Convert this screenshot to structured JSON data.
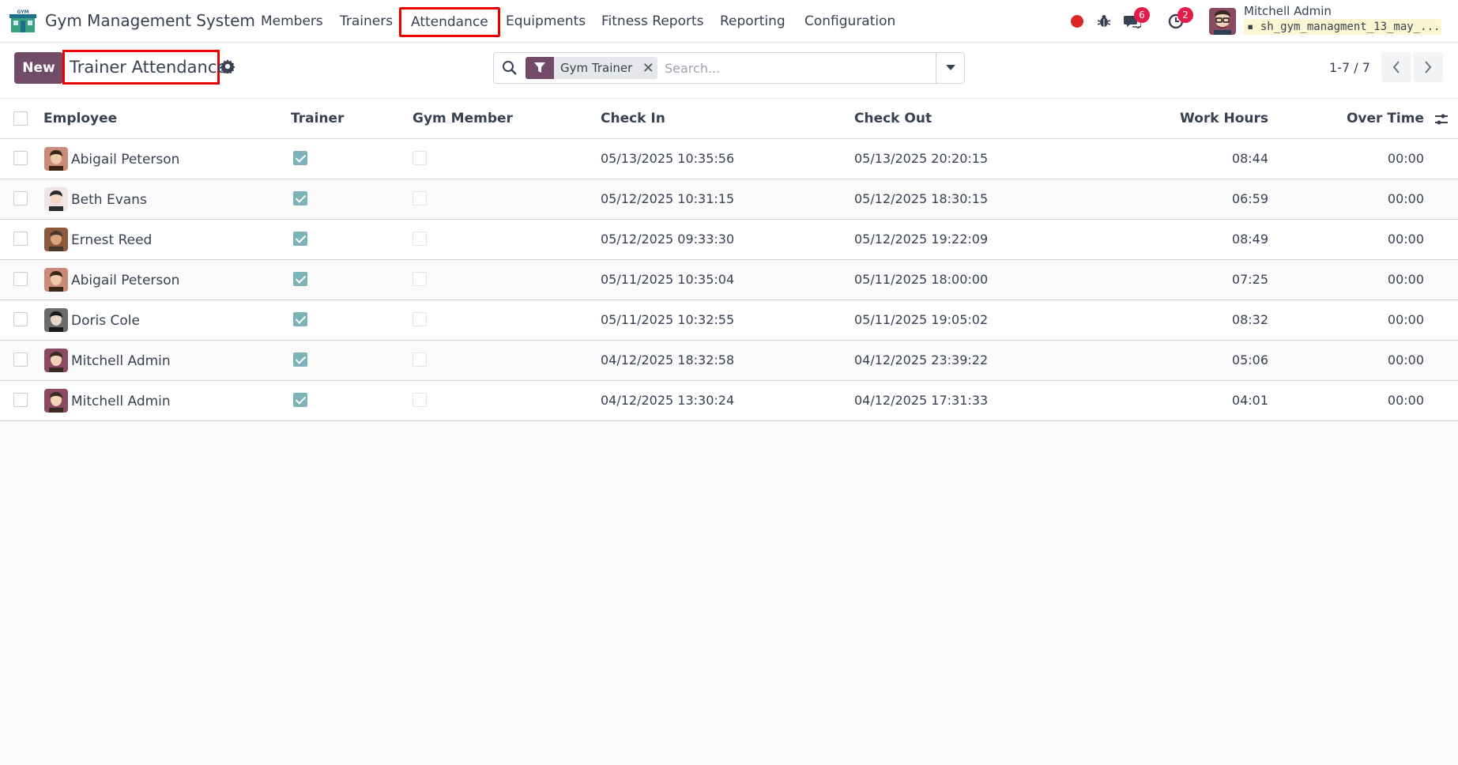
{
  "app": {
    "title": "Gym Management System",
    "menu": [
      "Members",
      "Trainers",
      "Attendance",
      "Equipments",
      "Fitness Reports",
      "Reporting",
      "Configuration"
    ],
    "active_menu": "Attendance"
  },
  "systray": {
    "messages_count": "6",
    "activities_count": "2",
    "user_name": "Mitchell Admin",
    "database": "sh_gym_managment_13_may_..."
  },
  "control": {
    "new_label": "New",
    "page_title": "Trainer Attendance",
    "filter_facet": "Gym Trainer",
    "search_placeholder": "Search...",
    "pager": "1-7 / 7"
  },
  "table": {
    "columns": {
      "employee": "Employee",
      "trainer": "Trainer",
      "gym_member": "Gym Member",
      "check_in": "Check In",
      "check_out": "Check Out",
      "work_hours": "Work Hours",
      "over_time": "Over Time"
    },
    "rows": [
      {
        "employee": "Abigail Peterson",
        "trainer": true,
        "gym_member": false,
        "check_in": "05/13/2025 10:35:56",
        "check_out": "05/13/2025 20:20:15",
        "work_hours": "08:44",
        "over_time": "00:00"
      },
      {
        "employee": "Beth Evans",
        "trainer": true,
        "gym_member": false,
        "check_in": "05/12/2025 10:31:15",
        "check_out": "05/12/2025 18:30:15",
        "work_hours": "06:59",
        "over_time": "00:00"
      },
      {
        "employee": "Ernest Reed",
        "trainer": true,
        "gym_member": false,
        "check_in": "05/12/2025 09:33:30",
        "check_out": "05/12/2025 19:22:09",
        "work_hours": "08:49",
        "over_time": "00:00"
      },
      {
        "employee": "Abigail Peterson",
        "trainer": true,
        "gym_member": false,
        "check_in": "05/11/2025 10:35:04",
        "check_out": "05/11/2025 18:00:00",
        "work_hours": "07:25",
        "over_time": "00:00"
      },
      {
        "employee": "Doris Cole",
        "trainer": true,
        "gym_member": false,
        "check_in": "05/11/2025 10:32:55",
        "check_out": "05/11/2025 19:05:02",
        "work_hours": "08:32",
        "over_time": "00:00"
      },
      {
        "employee": "Mitchell Admin",
        "trainer": true,
        "gym_member": false,
        "check_in": "04/12/2025 18:32:58",
        "check_out": "04/12/2025 23:39:22",
        "work_hours": "05:06",
        "over_time": "00:00"
      },
      {
        "employee": "Mitchell Admin",
        "trainer": true,
        "gym_member": false,
        "check_in": "04/12/2025 13:30:24",
        "check_out": "04/12/2025 17:31:33",
        "work_hours": "04:01",
        "over_time": "00:00"
      }
    ]
  },
  "colors": {
    "brand": "#714b67",
    "checkbox_checked": "#7cb3b8",
    "highlight": "#ee0000",
    "badge": "#e11d48"
  }
}
